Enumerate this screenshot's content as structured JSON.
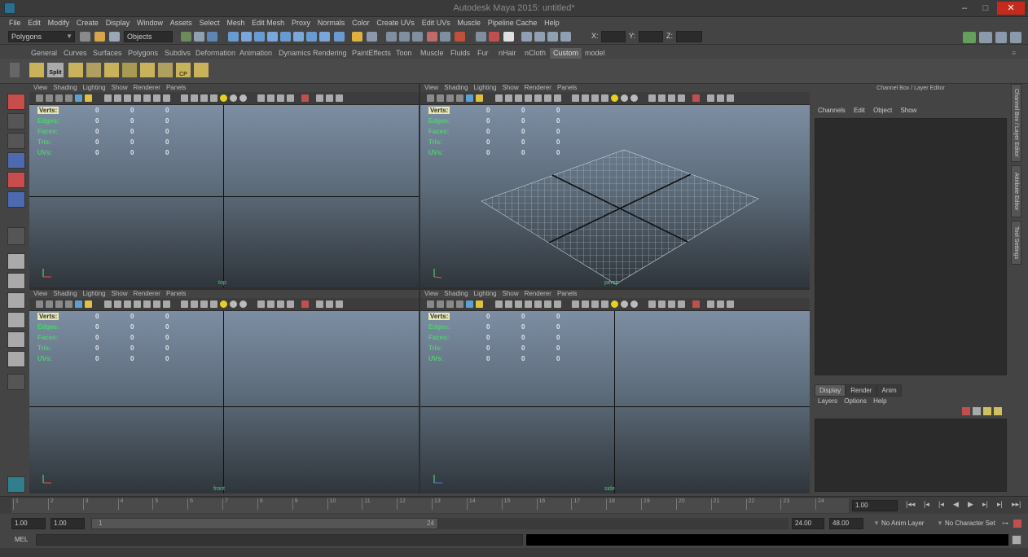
{
  "window": {
    "title": "Autodesk Maya 2015: untitled*"
  },
  "menubar": [
    "File",
    "Edit",
    "Modify",
    "Create",
    "Display",
    "Window",
    "Assets",
    "Select",
    "Mesh",
    "Edit Mesh",
    "Proxy",
    "Normals",
    "Color",
    "Create UVs",
    "Edit UVs",
    "Muscle",
    "Pipeline Cache",
    "Help"
  ],
  "statusline": {
    "mode": "Polygons",
    "selection_mode": "Objects",
    "x_label": "X:",
    "y_label": "Y:",
    "z_label": "Z:"
  },
  "shelf_tabs": [
    "General",
    "Curves",
    "Surfaces",
    "Polygons",
    "Subdivs",
    "Deformation",
    "Animation",
    "Dynamics",
    "Rendering",
    "PaintEffects",
    "Toon",
    "Muscle",
    "Fluids",
    "Fur",
    "nHair",
    "nCloth",
    "Custom",
    "model"
  ],
  "shelf_active_tab": "Custom",
  "shelf_icons": [
    {
      "label": "Split"
    },
    {
      "label": "CP"
    }
  ],
  "panel_menu": [
    "View",
    "Shading",
    "Lighting",
    "Show",
    "Renderer",
    "Panels"
  ],
  "hud": {
    "rows": [
      {
        "label": "Verts:",
        "v1": "0",
        "v2": "0",
        "v3": "0"
      },
      {
        "label": "Edges:",
        "v1": "0",
        "v2": "0",
        "v3": "0"
      },
      {
        "label": "Faces:",
        "v1": "0",
        "v2": "0",
        "v3": "0"
      },
      {
        "label": "Tris:",
        "v1": "0",
        "v2": "0",
        "v3": "0"
      },
      {
        "label": "UVs:",
        "v1": "0",
        "v2": "0",
        "v3": "0"
      }
    ]
  },
  "viewports": [
    {
      "camera": "top"
    },
    {
      "camera": "persp"
    },
    {
      "camera": "front"
    },
    {
      "camera": "side"
    }
  ],
  "channel_box": {
    "title": "Channel Box / Layer Editor",
    "menu": [
      "Channels",
      "Edit",
      "Object",
      "Show"
    ]
  },
  "side_tabs": [
    "Channel Box / Layer Editor",
    "Attribute Editor",
    "Tool Settings"
  ],
  "layer_editor": {
    "tabs": [
      "Display",
      "Render",
      "Anim"
    ],
    "active_tab": "Display",
    "menu": [
      "Layers",
      "Options",
      "Help"
    ]
  },
  "time_slider": {
    "ticks": [
      "1",
      "2",
      "3",
      "4",
      "5",
      "6",
      "7",
      "8",
      "9",
      "10",
      "11",
      "12",
      "13",
      "14",
      "15",
      "16",
      "17",
      "18",
      "19",
      "20",
      "21",
      "22",
      "23",
      "24"
    ],
    "current_frame": "1.00"
  },
  "range_slider": {
    "start_field": "1.00",
    "playback_start": "1.00",
    "range_start_label": "1",
    "range_end_label": "24",
    "playback_end": "24.00",
    "end_field": "48.00",
    "anim_layer": "No Anim Layer",
    "character_set": "No Character Set"
  },
  "command_line": {
    "label": "MEL"
  },
  "colors": {
    "accent_hud": "#50d070",
    "viewport_top": "#7d8ea3",
    "viewport_bottom": "#2f353b",
    "close_button": "#c42b1c"
  }
}
